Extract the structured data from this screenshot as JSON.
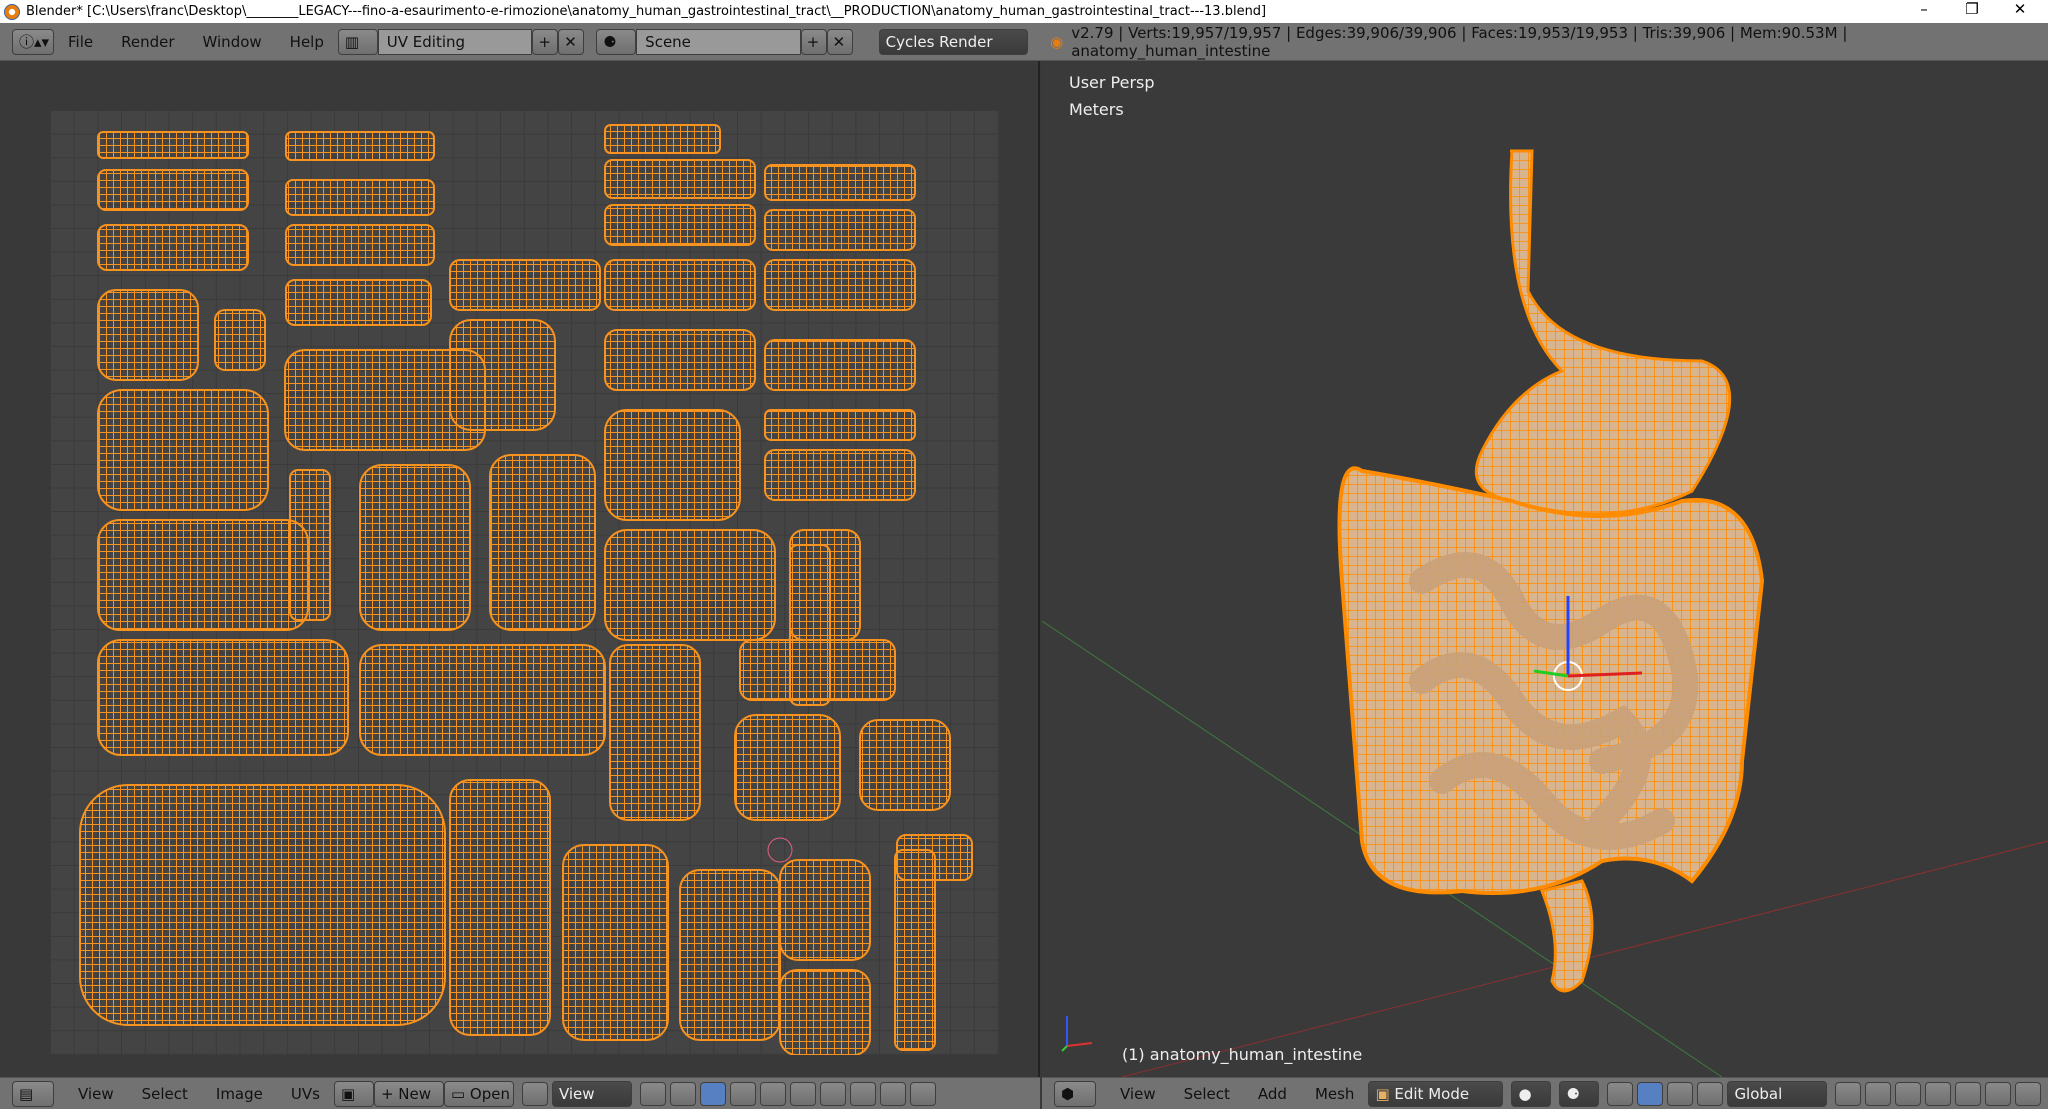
{
  "window": {
    "title": "Blender* [C:\\Users\\franc\\Desktop\\________LEGACY---fino-a-esaurimento-e-rimozione\\anatomy_human_gastrointestinal_tract\\__PRODUCTION\\anatomy_human_gastrointestinal_tract---13.blend]",
    "minimize": "–",
    "restore": "❐",
    "close": "✕"
  },
  "header": {
    "menus": [
      "File",
      "Render",
      "Window",
      "Help"
    ],
    "layout": "UV Editing",
    "scene": "Scene",
    "engine": "Cycles Render",
    "add": "+",
    "remove": "✕",
    "status": "v2.79 | Verts:19,957/19,957 | Edges:39,906/39,906 | Faces:19,953/19,953 | Tris:39,906 | Mem:90.53M | anatomy_human_intestine"
  },
  "uv_editor": {
    "menus": [
      "View",
      "Select",
      "Image",
      "UVs"
    ],
    "new": "New",
    "open": "Open",
    "view": "View"
  },
  "viewport": {
    "persp": "User Persp",
    "units": "Meters",
    "object": "(1) anatomy_human_intestine",
    "menus": [
      "View",
      "Select",
      "Add",
      "Mesh"
    ],
    "mode": "Edit Mode",
    "orientation": "Global"
  },
  "colors": {
    "uv": "#f7931e",
    "wire": "#ff8c00",
    "mesh": "#c9a27c"
  }
}
